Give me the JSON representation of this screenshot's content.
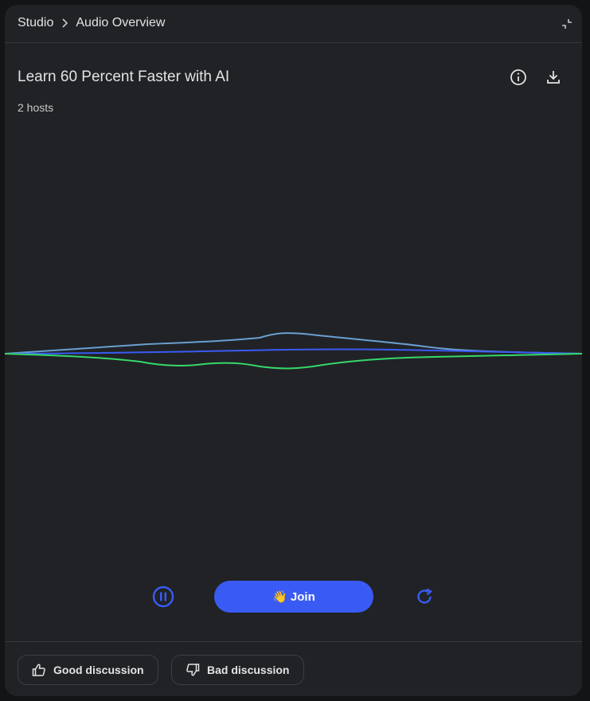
{
  "breadcrumb": {
    "root": "Studio",
    "current": "Audio Overview"
  },
  "overview": {
    "title": "Learn 60 Percent Faster with AI",
    "hosts": "2 hosts"
  },
  "player": {
    "join_label": "Join",
    "join_emoji": "👋"
  },
  "feedback": {
    "good_label": "Good discussion",
    "bad_label": "Bad discussion"
  },
  "colors": {
    "accent": "#3a5bf3",
    "wave_light_blue": "#6a9fd0",
    "wave_blue": "#3a5bf3",
    "wave_green": "#36d86a"
  }
}
